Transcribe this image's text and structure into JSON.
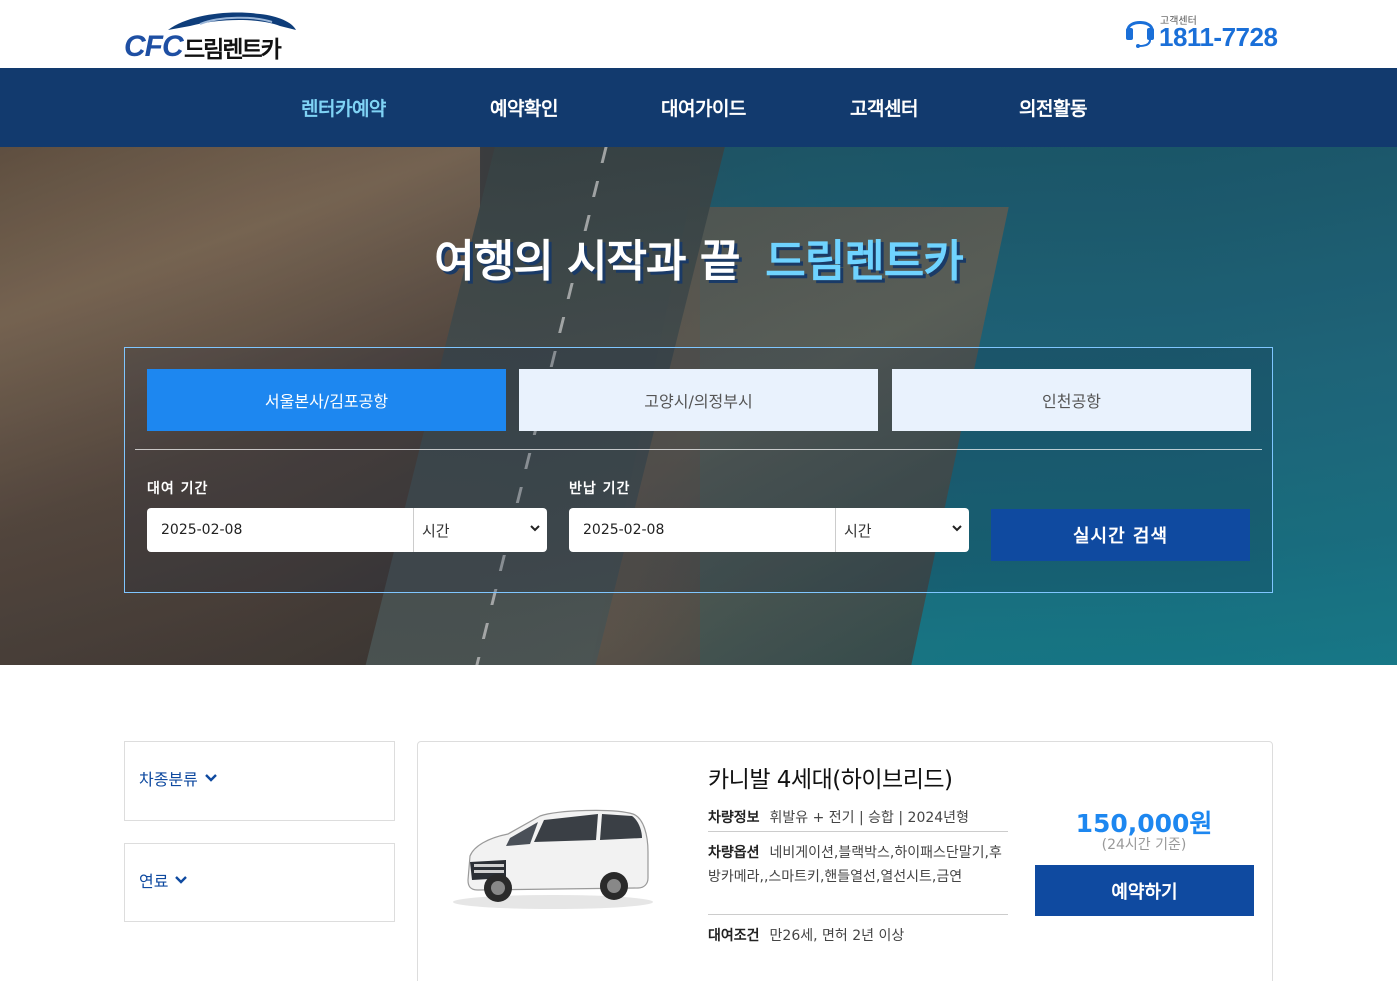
{
  "header": {
    "logo_text": "CFC",
    "logo_name": "드림렌트카",
    "cs_label": "고객센터",
    "cs_phone": "1811-7728",
    "icons": [
      "car-silhouette-icon",
      "headset-icon"
    ]
  },
  "nav": {
    "items": [
      {
        "label": "렌터카예약",
        "active": true
      },
      {
        "label": "예약확인",
        "active": false
      },
      {
        "label": "대여가이드",
        "active": false
      },
      {
        "label": "고객센터",
        "active": false
      },
      {
        "label": "의전활동",
        "active": false
      }
    ],
    "active_color": "#7fd3f5"
  },
  "hero": {
    "title_a": "여행의 시작과 끝",
    "title_b": "드림렌트카"
  },
  "search": {
    "tabs": [
      {
        "label": "서울본사/김포공항",
        "active": true
      },
      {
        "label": "고양시/의정부시",
        "active": false
      },
      {
        "label": "인천공항",
        "active": false
      }
    ],
    "pickup_label": "대여 기간",
    "pickup_date": "2025-02-08",
    "pickup_time": "시간",
    "return_label": "반납 기간",
    "return_date": "2025-02-08",
    "return_time": "시간",
    "search_button": "실시간 검색"
  },
  "filters": [
    {
      "label": "차종분류"
    },
    {
      "label": "연료"
    }
  ],
  "car": {
    "name": "카니발 4세대(하이브리드)",
    "info_label": "차량정보",
    "info_value": "휘발유 + 전기 | 승합 | 2024년형",
    "options_label": "차량옵션",
    "options_value": "네비게이션,블랙박스,하이패스단말기,후방카메라,,스마트키,핸들열선,열선시트,금연",
    "condition_label": "대여조건",
    "condition_value": "만26세, 면허 2년 이상",
    "price": "150,000원",
    "price_note": "(24시간 기준)",
    "book_button": "예약하기"
  },
  "colors": {
    "nav_bg": "#123a6e",
    "primary": "#0f4aa0",
    "accent": "#1d87f0"
  }
}
